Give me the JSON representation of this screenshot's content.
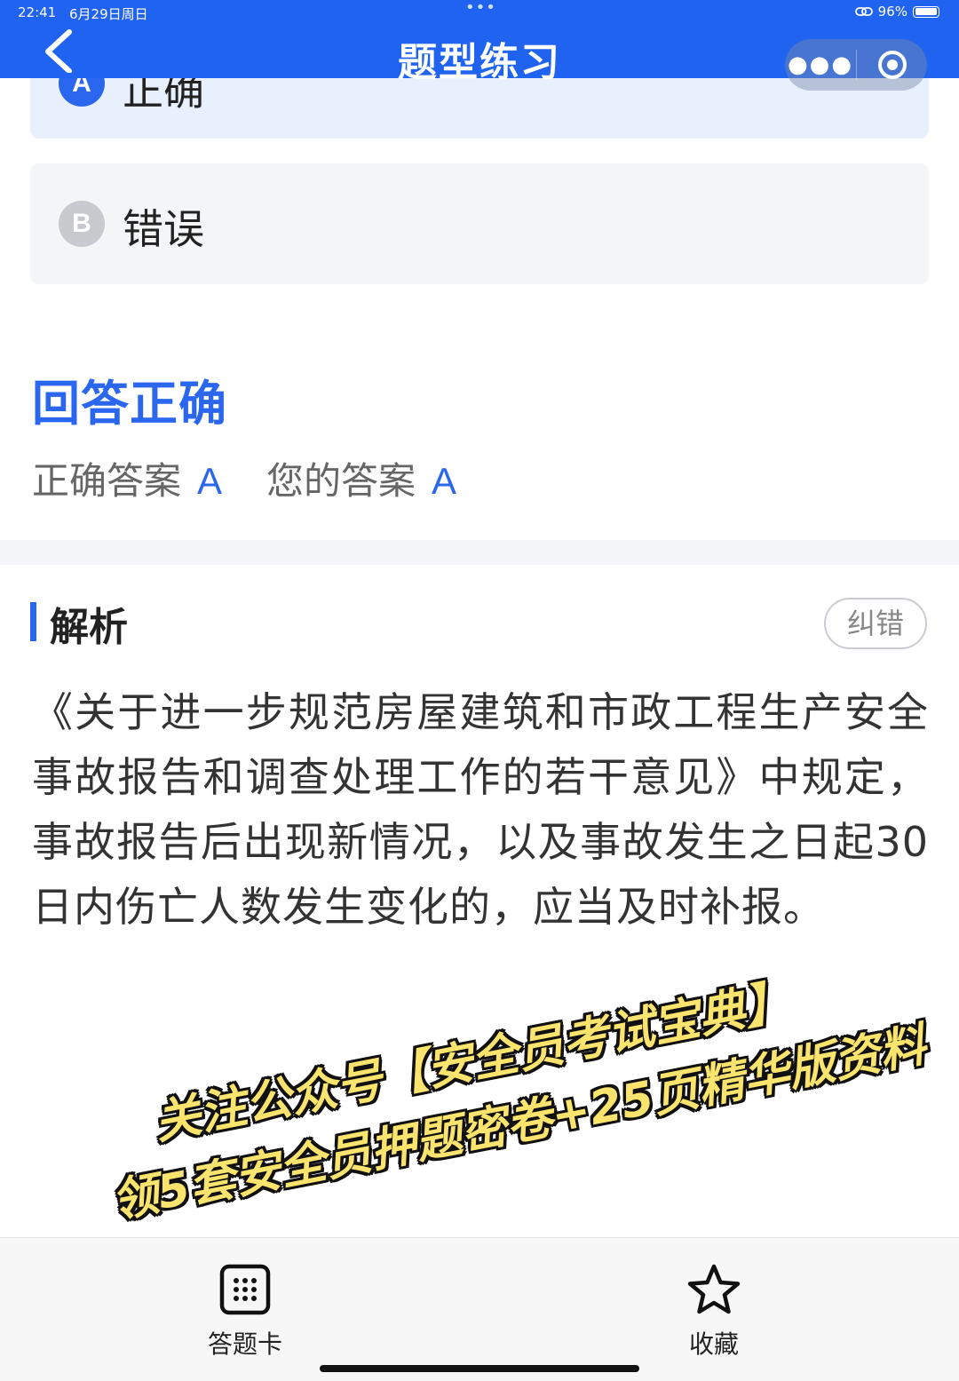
{
  "status_bar": {
    "time": "22:41",
    "date": "6月29日周日",
    "battery": "96%"
  },
  "header": {
    "title": "题型练习",
    "back_icon": "chevron-left-icon",
    "more_icon": "more-dots-icon",
    "close_icon": "target-icon"
  },
  "options": [
    {
      "letter": "A",
      "text": "正确",
      "state": "selected"
    },
    {
      "letter": "B",
      "text": "错误",
      "state": "default"
    }
  ],
  "result": {
    "status": "回答正确",
    "correct_label": "正确答案",
    "correct_value": "A",
    "your_label": "您的答案",
    "your_value": "A"
  },
  "analysis": {
    "title": "解析",
    "report_button": "纠错",
    "body": "《关于进一步规范房屋建筑和市政工程生产安全事故报告和调查处理工作的若干意见》中规定，事故报告后出现新情况，以及事故发生之日起30日内伤亡人数发生变化的，应当及时补报。"
  },
  "promo": {
    "line1": "关注公众号【安全员考试宝典】",
    "line2": "领5套安全员押题密卷+25页精华版资料"
  },
  "bottom_bar": {
    "answer_card": {
      "label": "答题卡",
      "icon": "grid-card-icon"
    },
    "favorite": {
      "label": "收藏",
      "icon": "star-icon"
    }
  },
  "colors": {
    "accent": "#1f63f0",
    "correct": "#2a66ee",
    "promo": "#fbe46d"
  }
}
